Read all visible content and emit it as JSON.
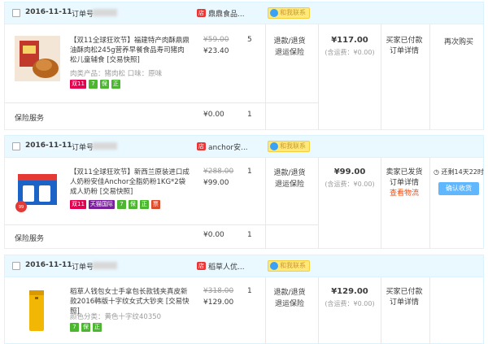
{
  "order_no_label": "订单号",
  "chat_label": "和我联系",
  "service_label": "保险服务",
  "orders": [
    {
      "date": "2016-11-11",
      "shop": "鼎鼎食品...",
      "item": {
        "title_prefix": "【双11全球狂欢节】",
        "title": "福建特产肉酥鼎鼎油酥肉松245g营养早餐食品寿司猪肉松儿童辅食 [交易快照]",
        "meta": "肉类产品：猪肉松   口味：原味",
        "orig_price": "¥59.00",
        "price": "¥23.40",
        "qty": "5"
      },
      "badges": [
        {
          "text": "双11",
          "color": "#e5004f"
        },
        {
          "text": "7",
          "color": "#4cb631"
        },
        {
          "text": "保",
          "color": "#4cb631"
        },
        {
          "text": "正",
          "color": "#4cb631"
        }
      ],
      "refund": [
        "退款/退货",
        "退运保险"
      ],
      "total": "¥117.00",
      "shipping": "(含运费：¥0.00)",
      "status": [
        "买家已付款",
        "订单详情"
      ],
      "status_highlight": "",
      "op": "再次购买",
      "service_price": "¥0.00",
      "service_qty": "1"
    },
    {
      "date": "2016-11-11",
      "shop": "anchor安...",
      "item": {
        "title_prefix": "【双11全球狂欢节】",
        "title": "新西兰原装进口成人奶粉安佳Anchor全脂奶粉1KG*2袋 成人奶粉 [交易快照]",
        "meta": "",
        "orig_price": "¥288.00",
        "price": "¥99.00",
        "qty": "1"
      },
      "badges": [
        {
          "text": "双11",
          "color": "#e5004f"
        },
        {
          "text": "天猫国际",
          "color": "#7a1f9c"
        },
        {
          "text": "7",
          "color": "#4cb631"
        },
        {
          "text": "保",
          "color": "#4cb631"
        },
        {
          "text": "正",
          "color": "#4cb631"
        },
        {
          "text": "票",
          "color": "#d84d2e"
        }
      ],
      "refund": [
        "退款/退货",
        "退运保险"
      ],
      "total": "¥99.00",
      "shipping": "(含运费：¥0.00)",
      "status": [
        "卖家已发货",
        "订单详情"
      ],
      "status_highlight": "查看物流",
      "countdown": "还剩14天22时",
      "confirm": "确认收货",
      "service_price": "¥0.00",
      "service_qty": "1"
    },
    {
      "date": "2016-11-11",
      "shop": "稻草人优...",
      "item": {
        "title_prefix": "",
        "title": "稻草人钱包女士手拿包长款钱夹真皮新款2016韩版十字纹女式大钞夹 [交易快照]",
        "meta": "颜色分类：黄色十字纹40350",
        "orig_price": "¥318.00",
        "price": "¥129.00",
        "qty": "1"
      },
      "badges": [
        {
          "text": "7",
          "color": "#4cb631"
        },
        {
          "text": "保",
          "color": "#4cb631"
        },
        {
          "text": "正",
          "color": "#4cb631"
        }
      ],
      "refund": [
        "退款/退货",
        "退运保险"
      ],
      "total": "¥129.00",
      "shipping": "(含运费：¥0.00)",
      "status": [
        "买家已付款",
        "订单详情"
      ],
      "status_highlight": ""
    }
  ]
}
